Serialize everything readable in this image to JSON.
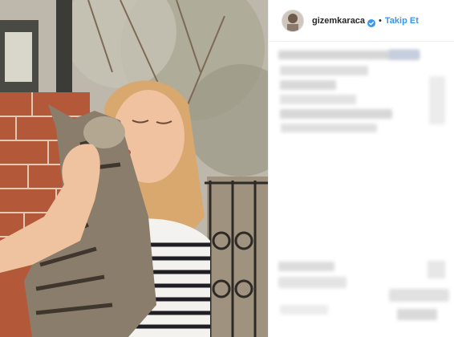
{
  "post": {
    "username": "gizemkaraca",
    "separator": "•",
    "follow_label": "Takip Et",
    "verified": true,
    "accent_color": "#3897f0",
    "icons": [
      "verified-badge-icon"
    ]
  }
}
